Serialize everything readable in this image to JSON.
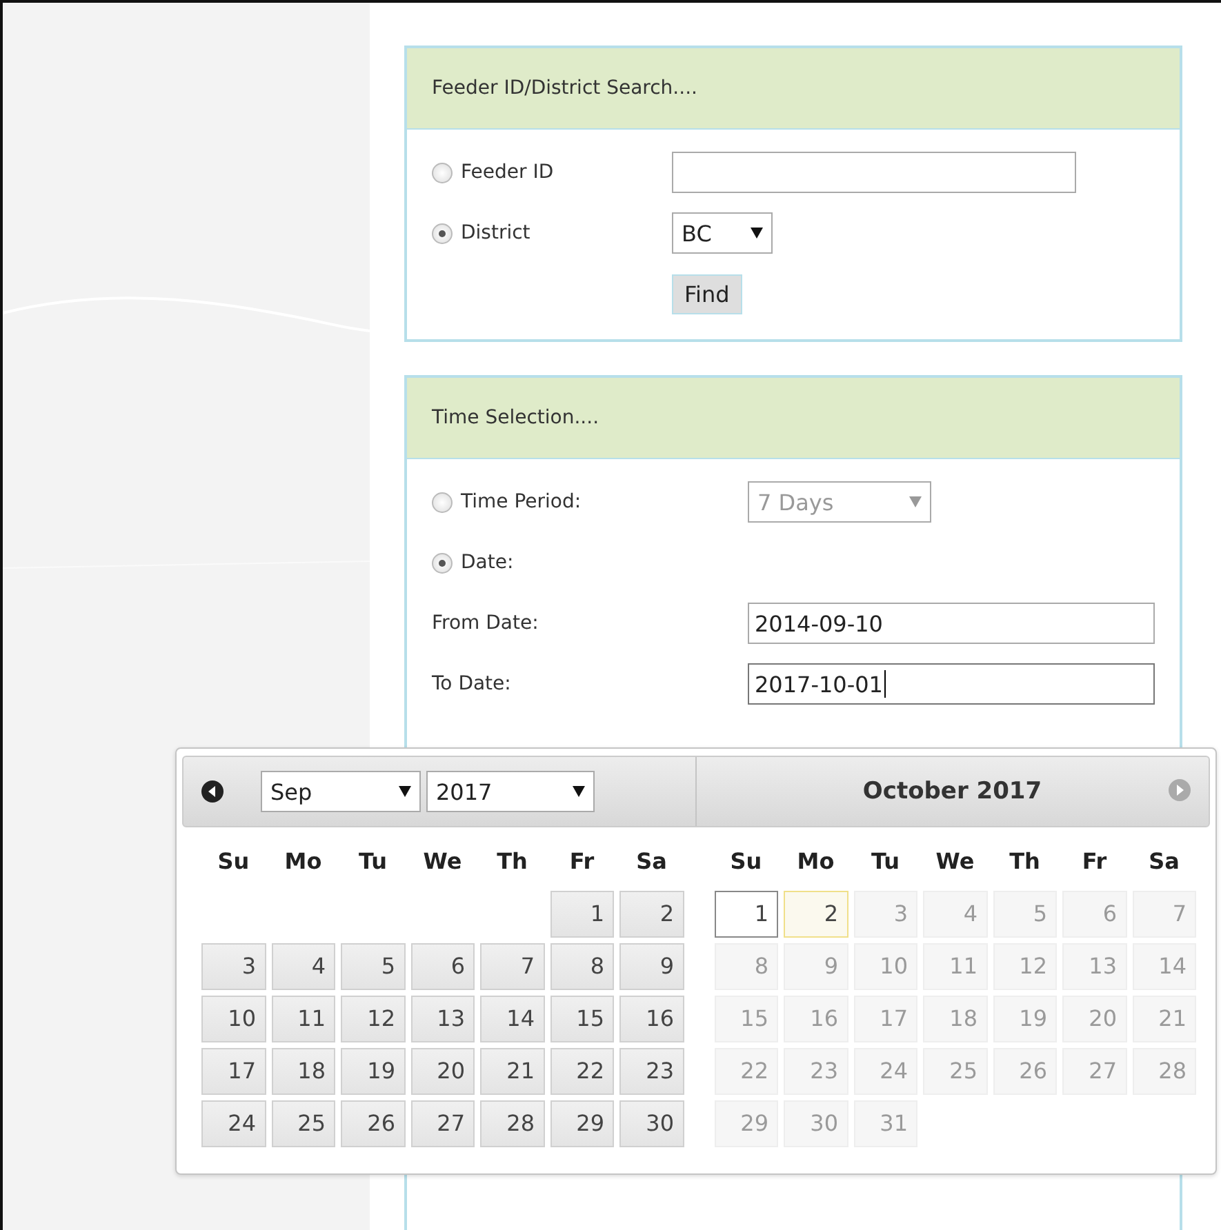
{
  "search_panel": {
    "title": "Feeder ID/District Search....",
    "options": [
      {
        "label": "Feeder ID",
        "selected": false,
        "kind": "text"
      },
      {
        "label": "District",
        "selected": true,
        "kind": "select",
        "value": "BC"
      }
    ],
    "button": "Find"
  },
  "time_panel": {
    "title": "Time Selection....",
    "options": [
      {
        "label": "Time Period:",
        "selected": false,
        "kind": "select",
        "value": "7 Days",
        "disabled": true
      },
      {
        "label": "Date:",
        "selected": true,
        "kind": "none"
      }
    ],
    "fields": [
      {
        "label": "From Date:",
        "value": "2014-09-10",
        "focused": false
      },
      {
        "label": "To Date:",
        "value": "2017-10-01",
        "focused": true
      }
    ]
  },
  "datepicker": {
    "month_select": "Sep",
    "year_select": "2017",
    "prev_disabled": false,
    "next_disabled": true,
    "months": [
      {
        "weekdays": [
          "Su",
          "Mo",
          "Tu",
          "We",
          "Th",
          "Fr",
          "Sa"
        ],
        "weeks": [
          [
            {
              "label": "1",
              "disabled": false,
              "selected": false,
              "highlighted": false
            },
            {
              "label": "2",
              "disabled": false,
              "selected": false,
              "highlighted": false
            }
          ],
          [
            {
              "label": "3",
              "disabled": false,
              "selected": false,
              "highlighted": false
            },
            {
              "label": "4",
              "disabled": false,
              "selected": false,
              "highlighted": false
            },
            {
              "label": "5",
              "disabled": false,
              "selected": false,
              "highlighted": false
            },
            {
              "label": "6",
              "disabled": false,
              "selected": false,
              "highlighted": false
            },
            {
              "label": "7",
              "disabled": false,
              "selected": false,
              "highlighted": false
            },
            {
              "label": "8",
              "disabled": false,
              "selected": false,
              "highlighted": false
            },
            {
              "label": "9",
              "disabled": false,
              "selected": false,
              "highlighted": false
            }
          ],
          [
            {
              "label": "10",
              "disabled": false,
              "selected": false,
              "highlighted": false
            },
            {
              "label": "11",
              "disabled": false,
              "selected": false,
              "highlighted": false
            },
            {
              "label": "12",
              "disabled": false,
              "selected": false,
              "highlighted": false
            },
            {
              "label": "13",
              "disabled": false,
              "selected": false,
              "highlighted": false
            },
            {
              "label": "14",
              "disabled": false,
              "selected": false,
              "highlighted": false
            },
            {
              "label": "15",
              "disabled": false,
              "selected": false,
              "highlighted": false
            },
            {
              "label": "16",
              "disabled": false,
              "selected": false,
              "highlighted": false
            }
          ],
          [
            {
              "label": "17",
              "disabled": false,
              "selected": false,
              "highlighted": false
            },
            {
              "label": "18",
              "disabled": false,
              "selected": false,
              "highlighted": false
            },
            {
              "label": "19",
              "disabled": false,
              "selected": false,
              "highlighted": false
            },
            {
              "label": "20",
              "disabled": false,
              "selected": false,
              "highlighted": false
            },
            {
              "label": "21",
              "disabled": false,
              "selected": false,
              "highlighted": false
            },
            {
              "label": "22",
              "disabled": false,
              "selected": false,
              "highlighted": false
            },
            {
              "label": "23",
              "disabled": false,
              "selected": false,
              "highlighted": false
            }
          ],
          [
            {
              "label": "24",
              "disabled": false,
              "selected": false,
              "highlighted": false
            },
            {
              "label": "25",
              "disabled": false,
              "selected": false,
              "highlighted": false
            },
            {
              "label": "26",
              "disabled": false,
              "selected": false,
              "highlighted": false
            },
            {
              "label": "27",
              "disabled": false,
              "selected": false,
              "highlighted": false
            },
            {
              "label": "28",
              "disabled": false,
              "selected": false,
              "highlighted": false
            },
            {
              "label": "29",
              "disabled": false,
              "selected": false,
              "highlighted": false
            },
            {
              "label": "30",
              "disabled": false,
              "selected": false,
              "highlighted": false
            }
          ]
        ]
      },
      {
        "title": "October 2017",
        "weekdays": [
          "Su",
          "Mo",
          "Tu",
          "We",
          "Th",
          "Fr",
          "Sa"
        ],
        "weeks": [
          [
            {
              "label": "1",
              "disabled": false,
              "selected": true,
              "highlighted": false
            },
            {
              "label": "2",
              "disabled": false,
              "selected": false,
              "highlighted": true
            },
            {
              "label": "3",
              "disabled": true,
              "selected": false,
              "highlighted": false
            },
            {
              "label": "4",
              "disabled": true,
              "selected": false,
              "highlighted": false
            },
            {
              "label": "5",
              "disabled": true,
              "selected": false,
              "highlighted": false
            },
            {
              "label": "6",
              "disabled": true,
              "selected": false,
              "highlighted": false
            },
            {
              "label": "7",
              "disabled": true,
              "selected": false,
              "highlighted": false
            }
          ],
          [
            {
              "label": "8",
              "disabled": true,
              "selected": false,
              "highlighted": false
            },
            {
              "label": "9",
              "disabled": true,
              "selected": false,
              "highlighted": false
            },
            {
              "label": "10",
              "disabled": true,
              "selected": false,
              "highlighted": false
            },
            {
              "label": "11",
              "disabled": true,
              "selected": false,
              "highlighted": false
            },
            {
              "label": "12",
              "disabled": true,
              "selected": false,
              "highlighted": false
            },
            {
              "label": "13",
              "disabled": true,
              "selected": false,
              "highlighted": false
            },
            {
              "label": "14",
              "disabled": true,
              "selected": false,
              "highlighted": false
            }
          ],
          [
            {
              "label": "15",
              "disabled": true,
              "selected": false,
              "highlighted": false
            },
            {
              "label": "16",
              "disabled": true,
              "selected": false,
              "highlighted": false
            },
            {
              "label": "17",
              "disabled": true,
              "selected": false,
              "highlighted": false
            },
            {
              "label": "18",
              "disabled": true,
              "selected": false,
              "highlighted": false
            },
            {
              "label": "19",
              "disabled": true,
              "selected": false,
              "highlighted": false
            },
            {
              "label": "20",
              "disabled": true,
              "selected": false,
              "highlighted": false
            },
            {
              "label": "21",
              "disabled": true,
              "selected": false,
              "highlighted": false
            }
          ],
          [
            {
              "label": "22",
              "disabled": true,
              "selected": false,
              "highlighted": false
            },
            {
              "label": "23",
              "disabled": true,
              "selected": false,
              "highlighted": false
            },
            {
              "label": "24",
              "disabled": true,
              "selected": false,
              "highlighted": false
            },
            {
              "label": "25",
              "disabled": true,
              "selected": false,
              "highlighted": false
            },
            {
              "label": "26",
              "disabled": true,
              "selected": false,
              "highlighted": false
            },
            {
              "label": "27",
              "disabled": true,
              "selected": false,
              "highlighted": false
            },
            {
              "label": "28",
              "disabled": true,
              "selected": false,
              "highlighted": false
            }
          ],
          [
            {
              "label": "29",
              "disabled": true,
              "selected": false,
              "highlighted": false
            },
            {
              "label": "30",
              "disabled": true,
              "selected": false,
              "highlighted": false
            },
            {
              "label": "31",
              "disabled": true,
              "selected": false,
              "highlighted": false
            }
          ]
        ]
      }
    ]
  }
}
